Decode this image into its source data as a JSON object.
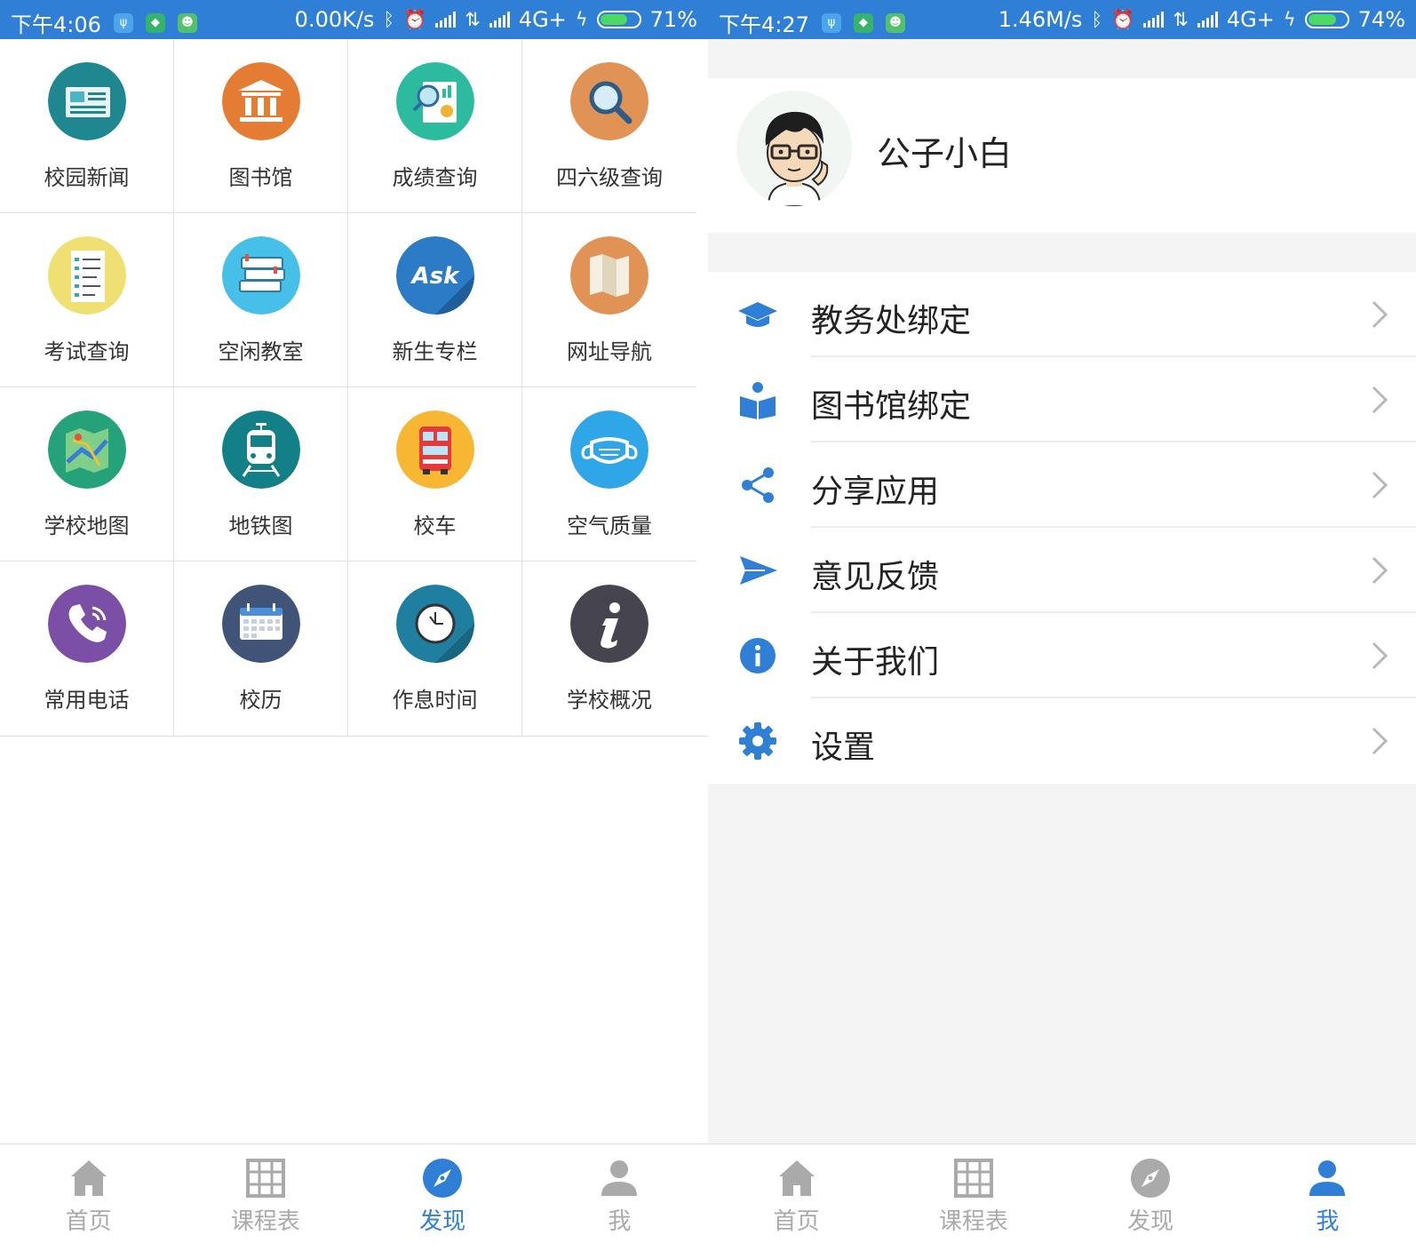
{
  "colors": {
    "accent": "#2f7fd6",
    "inactive_tab": "#aaaaaa",
    "battery_fill": "#4cd964"
  },
  "left": {
    "status_bar": {
      "time": "下午4:06",
      "speed": "0.00K/s",
      "network": "4G+",
      "battery": "71%",
      "battery_level": 0.71
    },
    "grid": [
      {
        "label": "校园新闻",
        "icon": "newspaper-icon"
      },
      {
        "label": "图书馆",
        "icon": "library-icon"
      },
      {
        "label": "成绩查询",
        "icon": "grade-report-icon"
      },
      {
        "label": "四六级查询",
        "icon": "magnifier-icon"
      },
      {
        "label": "考试查询",
        "icon": "checklist-icon"
      },
      {
        "label": "空闲教室",
        "icon": "books-icon"
      },
      {
        "label": "新生专栏",
        "icon": "ask-icon"
      },
      {
        "label": "网址导航",
        "icon": "folded-map-icon"
      },
      {
        "label": "学校地图",
        "icon": "map-icon"
      },
      {
        "label": "地铁图",
        "icon": "metro-icon"
      },
      {
        "label": "校车",
        "icon": "bus-icon"
      },
      {
        "label": "空气质量",
        "icon": "mask-icon"
      },
      {
        "label": "常用电话",
        "icon": "phone-icon"
      },
      {
        "label": "校历",
        "icon": "calendar-icon"
      },
      {
        "label": "作息时间",
        "icon": "clock-icon"
      },
      {
        "label": "学校概况",
        "icon": "info-icon"
      }
    ],
    "tabs": [
      {
        "label": "首页",
        "icon": "home-icon"
      },
      {
        "label": "课程表",
        "icon": "grid-icon"
      },
      {
        "label": "发现",
        "icon": "compass-icon"
      },
      {
        "label": "我",
        "icon": "person-icon"
      }
    ],
    "active_tab": "发现"
  },
  "right": {
    "status_bar": {
      "time": "下午4:27",
      "speed": "1.46M/s",
      "network": "4G+",
      "battery": "74%",
      "battery_level": 0.74
    },
    "profile": {
      "username": "公子小白",
      "avatar": "cartoon-boy-avatar"
    },
    "menu": [
      {
        "label": "教务处绑定",
        "icon": "graduation-cap-icon"
      },
      {
        "label": "图书馆绑定",
        "icon": "reader-icon"
      },
      {
        "label": "分享应用",
        "icon": "share-icon"
      },
      {
        "label": "意见反馈",
        "icon": "send-icon"
      },
      {
        "label": "关于我们",
        "icon": "info-circle-icon"
      },
      {
        "label": "设置",
        "icon": "gear-icon"
      }
    ],
    "tabs": [
      {
        "label": "首页",
        "icon": "home-icon"
      },
      {
        "label": "课程表",
        "icon": "grid-icon"
      },
      {
        "label": "发现",
        "icon": "compass-icon"
      },
      {
        "label": "我",
        "icon": "person-icon"
      }
    ],
    "active_tab": "我"
  }
}
